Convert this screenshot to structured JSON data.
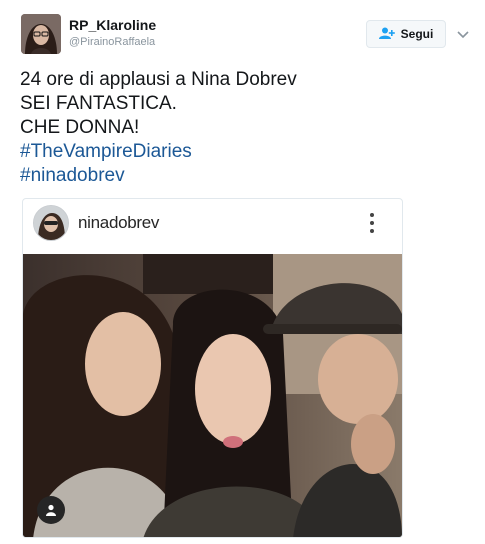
{
  "user": {
    "display_name": "RP_Klaroline",
    "handle": "@PirainoRaffaela"
  },
  "follow_button": {
    "label": "Segui",
    "icon": "add-user-icon"
  },
  "tweet": {
    "lines": [
      "24 ore di applausi a Nina Dobrev",
      "SEI FANTASTICA.",
      "CHE DONNA!"
    ],
    "hashtags": [
      "#TheVampireDiaries",
      "#ninadobrev"
    ]
  },
  "embed": {
    "username": "ninadobrev",
    "menu_icon": "more-vertical-icon",
    "tag_icon": "user-tag-icon"
  },
  "colors": {
    "hashtag": "#1c5896",
    "follow_button_bg": "#f5f8fa",
    "border": "#e1e8ed",
    "handle": "#8a959e"
  }
}
